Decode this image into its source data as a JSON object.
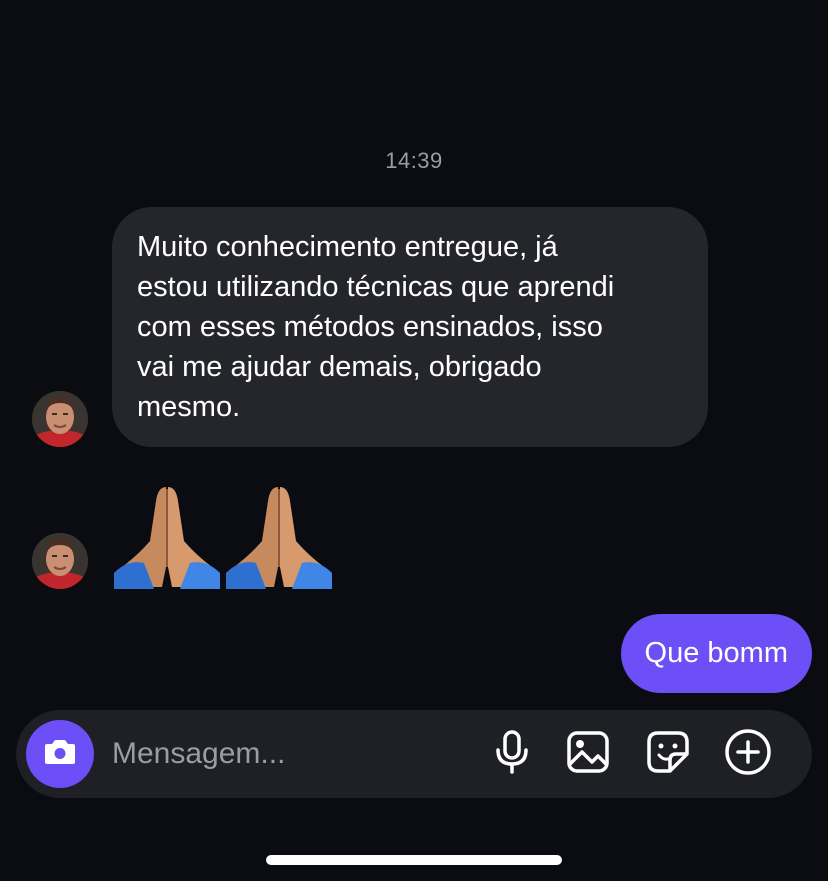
{
  "conversation": {
    "timestamp": "14:39",
    "incoming_message": {
      "lines": [
        "Muito conhecimento entregue, já",
        "estou utilizando técnicas que aprendi",
        "com esses métodos ensinados, isso",
        "vai me ajudar demais, obrigado",
        "mesmo."
      ]
    },
    "emoji_message": {
      "emojis": [
        "folded-hands-icon",
        "folded-hands-icon"
      ]
    },
    "outgoing_message": {
      "text": "Que bomm"
    }
  },
  "composer": {
    "placeholder": "Mensagem...",
    "icons": [
      "camera-icon",
      "microphone-icon",
      "gallery-icon",
      "sticker-icon",
      "plus-circle-icon"
    ]
  },
  "colors": {
    "background": "#0b0c12",
    "incoming_bubble": "#25262c",
    "accent": "#6c4ff6",
    "composer": "#1f2026",
    "muted_text": "#9a9ca6"
  }
}
